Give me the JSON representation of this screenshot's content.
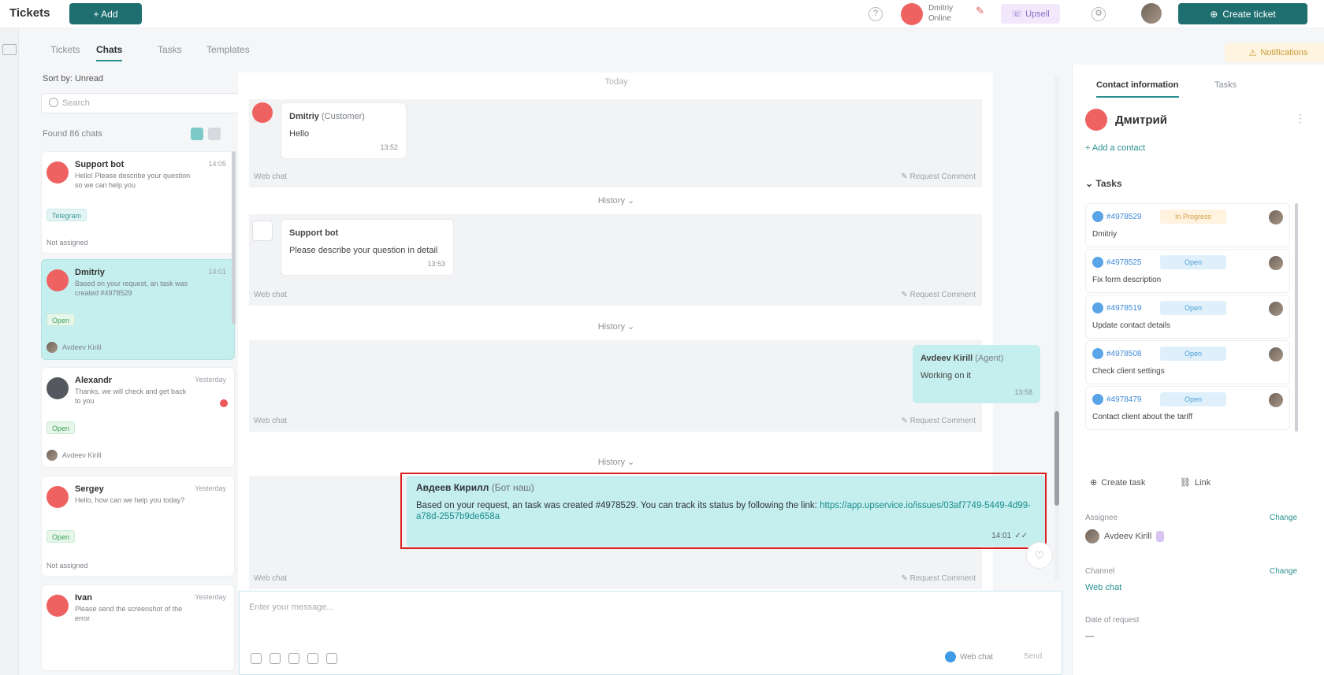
{
  "topbar": {
    "app_title": "Tickets",
    "add_button": "+ Add",
    "agent_name": "Dmitriy",
    "agent_status": "Online",
    "purple_chip": "Upsell",
    "cta_button": "Create ticket"
  },
  "subnav": {
    "tabs": [
      "Tickets",
      "Chats",
      "Tasks",
      "Templates"
    ],
    "active_index": 1,
    "warning_chip": "Notifications"
  },
  "leftpanel": {
    "sort_label": "Sort by: Unread",
    "search_placeholder": "Search",
    "found_label": "Found 86 chats",
    "cards": [
      {
        "name": "Support bot",
        "time": "14:05",
        "preview": "Hello! Please describe your question so we can help you",
        "tag": "Telegram",
        "footer": "Not assigned"
      },
      {
        "name": "Dmitriy",
        "time": "14:01",
        "preview": "Based on your request, an task was created #4978529",
        "tag": "Open",
        "footer": "Avdeev Kirill"
      },
      {
        "name": "Alexandr",
        "time": "Yesterday",
        "preview": "Thanks, we will check and get back to you",
        "tag": "Open",
        "footer": "Avdeev Kirill"
      },
      {
        "name": "Sergey",
        "time": "Yesterday",
        "preview": "Hello, how can we help you today?",
        "tag": "Open",
        "footer": "Not assigned"
      },
      {
        "name": "Ivan",
        "time": "Yesterday",
        "preview": "Please send the screenshot of the error",
        "tag": "",
        "footer": ""
      }
    ]
  },
  "chat": {
    "top_divider": "Today",
    "history_label": "History",
    "messages": [
      {
        "author": "Dmitriy",
        "sub": "(Customer)",
        "text": "Hello",
        "time": "13:52",
        "meta_left": "Web chat",
        "meta_right": "Request Comment"
      },
      {
        "author": "Support bot",
        "sub": "",
        "text": "Please describe your question in detail",
        "time": "13:53",
        "meta_left": "Web chat",
        "meta_right": "Request Comment"
      },
      {
        "author": "Avdeev Kirill",
        "sub": "(Agent)",
        "text": "Working on it",
        "time": "13:58",
        "meta_left": "Web chat",
        "meta_right": "Request Comment"
      }
    ],
    "main_message": {
      "author": "Авдеев Кирилл",
      "sub": "(Бот наш)",
      "text": "Based on your request, an task was created #4978529. You can track its status by following the link: ",
      "link": "https://app.upservice.io/issues/03af7749-5449-4d99-a78d-2557b9de658a",
      "time": "14:01",
      "meta_left": "Web chat",
      "meta_right": "Request Comment"
    },
    "composer_placeholder": "Enter your message...",
    "send_channel": "Web chat",
    "send_label": "Send"
  },
  "rightpanel": {
    "tabs": [
      "Contact information",
      "Tasks"
    ],
    "contact_name": "Дмитрий",
    "add_contact": "Add a contact",
    "section_tasks": "Tasks",
    "tasks": [
      {
        "id": "#4978529",
        "status": "In Progress",
        "status_color": "orange",
        "title": "Dmitriy"
      },
      {
        "id": "#4978525",
        "status": "Open",
        "status_color": "blue",
        "title": "Fix form description"
      },
      {
        "id": "#4978519",
        "status": "Open",
        "status_color": "blue",
        "title": "Update contact details"
      },
      {
        "id": "#4978508",
        "status": "Open",
        "status_color": "blue",
        "title": "Check client settings"
      },
      {
        "id": "#4978479",
        "status": "Open",
        "status_color": "blue",
        "title": "Contact client about the tariff"
      }
    ],
    "btn_create": "Create task",
    "btn_link": "Link",
    "assignee_label": "Assignee",
    "assignee_action": "Change",
    "assignee_name": "Avdeev Kirill",
    "channel_label": "Channel",
    "channel_action": "Change",
    "channel_value": "Web chat",
    "date_label": "Date of request",
    "date_value": "—"
  }
}
